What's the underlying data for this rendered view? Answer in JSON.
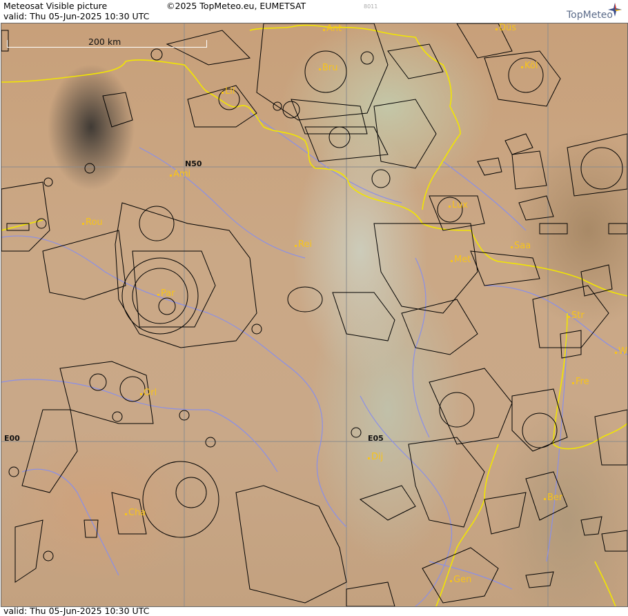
{
  "header": {
    "title": "Meteosat Visible picture",
    "copyright": "©2025 TopMeteo.eu, EUMETSAT",
    "stamp": "8011",
    "valid_top": "valid:  Thu  05-Jun-2025  10:30 UTC",
    "valid_bottom": "valid:  Thu  05-Jun-2025  10:30 UTC",
    "logo": "TopMeteo"
  },
  "scale": {
    "label": "200 km"
  },
  "grid_labels": {
    "lat": "N50",
    "lon_w": "E00",
    "lon_e": "E05"
  },
  "cities": [
    {
      "key": "ant",
      "label": "Ant"
    },
    {
      "key": "dus",
      "label": "Düs"
    },
    {
      "key": "bru",
      "label": "Bru"
    },
    {
      "key": "kol",
      "label": "Köl"
    },
    {
      "key": "lil",
      "label": "Lil"
    },
    {
      "key": "ami",
      "label": "Ami"
    },
    {
      "key": "rou",
      "label": "Rou"
    },
    {
      "key": "lux",
      "label": "Lux"
    },
    {
      "key": "rei",
      "label": "Rei"
    },
    {
      "key": "saa",
      "label": "Saa"
    },
    {
      "key": "met",
      "label": "Met"
    },
    {
      "key": "par",
      "label": "Par"
    },
    {
      "key": "str",
      "label": "Str"
    },
    {
      "key": "wu",
      "label": "W"
    },
    {
      "key": "orl",
      "label": "Orl"
    },
    {
      "key": "fre",
      "label": "Fre"
    },
    {
      "key": "dij",
      "label": "Dij"
    },
    {
      "key": "ber",
      "label": "Ber"
    },
    {
      "key": "cha",
      "label": "Cha"
    },
    {
      "key": "gen",
      "label": "Gen"
    }
  ],
  "colors": {
    "border": "#f2e600",
    "river": "#8a8fe8",
    "airspace": "#000000",
    "city": "#f7c41a",
    "grid": "#8c8c8c"
  }
}
